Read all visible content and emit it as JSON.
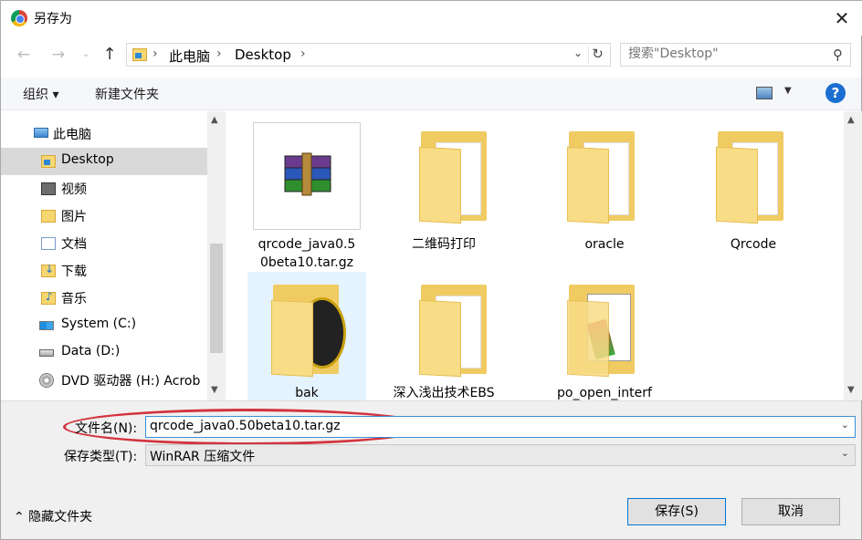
{
  "window": {
    "title": "另存为",
    "close_glyph": "✕"
  },
  "nav": {
    "back_glyph": "←",
    "forward_glyph": "→",
    "history_glyph": "⌄",
    "up_glyph": "↑"
  },
  "address": {
    "crumbs": [
      "此电脑",
      "Desktop"
    ],
    "separator": "›",
    "dropdown_glyph": "⌄",
    "refresh_glyph": "↻"
  },
  "search": {
    "placeholder": "搜索\"Desktop\"",
    "icon_glyph": "⚲"
  },
  "toolbar": {
    "organize_label": "组织 ▾",
    "new_folder_label": "新建文件夹",
    "view_dropdown_glyph": "▼",
    "help_glyph": "?"
  },
  "sidebar": {
    "items": [
      {
        "label": "此电脑",
        "icon": "computer-icon"
      },
      {
        "label": "Desktop",
        "icon": "desktop-folder-icon",
        "selected": true
      },
      {
        "label": "视频",
        "icon": "video-folder-icon"
      },
      {
        "label": "图片",
        "icon": "pictures-folder-icon"
      },
      {
        "label": "文档",
        "icon": "documents-folder-icon"
      },
      {
        "label": "下载",
        "icon": "downloads-folder-icon"
      },
      {
        "label": "音乐",
        "icon": "music-folder-icon"
      },
      {
        "label": "System (C:)",
        "icon": "windows-drive-icon"
      },
      {
        "label": "Data (D:)",
        "icon": "drive-icon"
      },
      {
        "label": "DVD 驱动器 (H:) Acrob",
        "icon": "dvd-drive-icon"
      }
    ],
    "scroll_up_glyph": "▲",
    "scroll_down_glyph": "▼"
  },
  "files": [
    {
      "name_line1": "qrcode_java0.5",
      "name_line2": "0beta10.tar.gz",
      "icon": "winrar-archive-icon"
    },
    {
      "name_line1": "二维码打印",
      "name_line2": "",
      "icon": "folder-icon"
    },
    {
      "name_line1": "oracle",
      "name_line2": "",
      "icon": "folder-icon"
    },
    {
      "name_line1": "Qrcode",
      "name_line2": "",
      "icon": "folder-icon"
    },
    {
      "name_line1": "bak",
      "name_line2": "",
      "icon": "folder-icon",
      "selected": true
    },
    {
      "name_line1": "深入浅出技术EBS",
      "name_line2": "",
      "icon": "folder-icon"
    },
    {
      "name_line1": "po_open_interf",
      "name_line2": "",
      "icon": "folder-icon"
    }
  ],
  "form": {
    "filename_label": "文件名(N):",
    "filename_value": "qrcode_java0.50beta10.tar.gz",
    "filetype_label": "保存类型(T):",
    "filetype_value": "WinRAR 压缩文件",
    "dropdown_glyph": "⌄",
    "hide_folders_label": "⌃  隐藏文件夹",
    "save_label": "保存(S)",
    "cancel_label": "取消"
  },
  "colors": {
    "accent": "#0078d7",
    "highlight_ring": "#d3333d",
    "selection": "#d9d9d9"
  }
}
